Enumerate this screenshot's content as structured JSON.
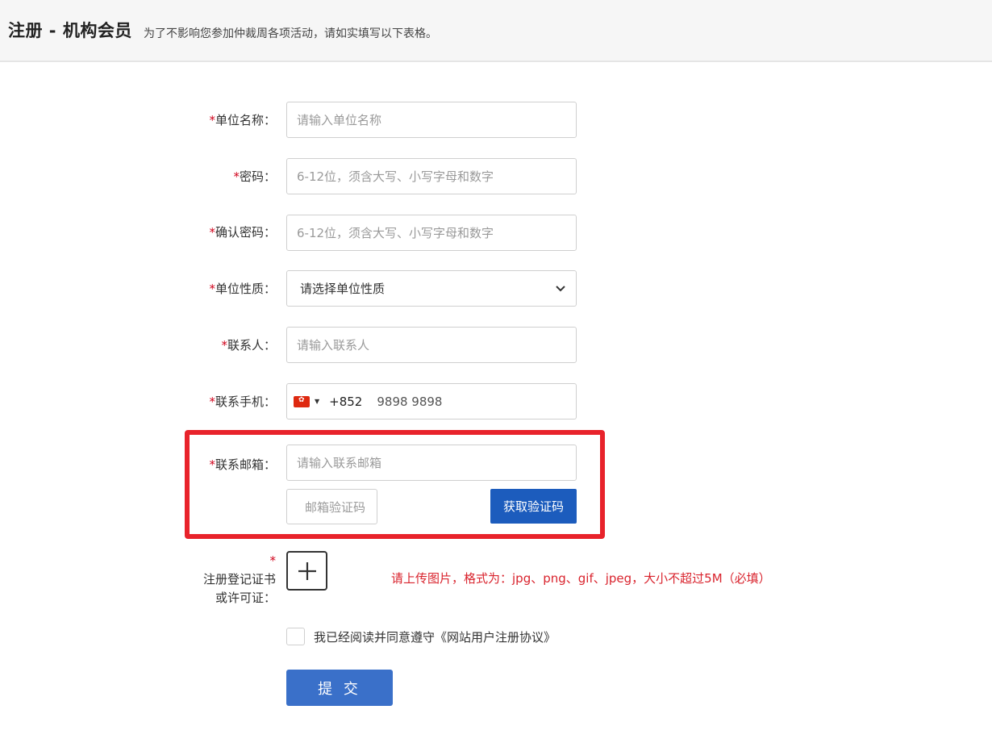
{
  "header": {
    "title": "注册 - 机构会员",
    "subtitle": "为了不影响您参加仲裁周各项活动，请如实填写以下表格。"
  },
  "required_mark": "*",
  "fields": {
    "org_name": {
      "label": "单位名称：",
      "placeholder": "请输入单位名称"
    },
    "password": {
      "label": "密码：",
      "placeholder": "6-12位，须含大写、小写字母和数字"
    },
    "confirm_password": {
      "label": "确认密码：",
      "placeholder": "6-12位，须含大写、小写字母和数字"
    },
    "org_type": {
      "label": "单位性质：",
      "selected": "请选择单位性质"
    },
    "contact_person": {
      "label": "联系人：",
      "placeholder": "请输入联系人"
    },
    "phone": {
      "label": "联系手机：",
      "flag_icon": "hong-kong-flag-icon",
      "dial_code": "+852",
      "value": "9898 9898"
    },
    "email": {
      "label": "联系邮箱：",
      "placeholder": "请输入联系邮箱"
    },
    "email_code": {
      "placeholder": "邮箱验证码",
      "button": "获取验证码"
    },
    "upload": {
      "label_line1": "注册登记证书",
      "label_line2": "或许可证：",
      "hint": "请上传图片，格式为：jpg、png、gif、jpeg，大小不超过5M（必填）",
      "icon": "plus-icon"
    }
  },
  "agreement": {
    "text": "我已经阅读并同意遵守《网站用户注册协议》"
  },
  "submit": {
    "label": "提 交"
  },
  "colors": {
    "primary_button": "#1c5cbd",
    "submit_button": "#3a70c9",
    "required": "#d0021b",
    "highlight": "#e8232b",
    "hint": "#d9232d"
  }
}
